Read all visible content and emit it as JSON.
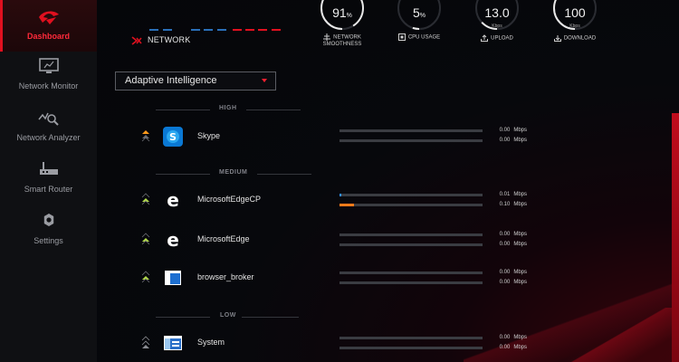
{
  "sidebar": {
    "items": [
      {
        "label": "Dashboard",
        "icon": "rog-eye-icon",
        "active": true
      },
      {
        "label": "Network Monitor",
        "icon": "monitor-icon"
      },
      {
        "label": "Network Analyzer",
        "icon": "analyzer-icon"
      },
      {
        "label": "Smart Router",
        "icon": "router-icon"
      },
      {
        "label": "Settings",
        "icon": "gear-icon"
      }
    ]
  },
  "stats": {
    "network_label": "NETWORK",
    "smoothness": {
      "value": "91",
      "unit": "%",
      "label": "NETWORK SMOOTHNESS",
      "fraction": 0.91
    },
    "cpu": {
      "value": "5",
      "unit": "%",
      "label": "CPU USAGE",
      "fraction": 0.05
    },
    "upload": {
      "value": "13.0",
      "unit": "Kbps",
      "label": "UPLOAD",
      "fraction": 0.13
    },
    "download": {
      "value": "100",
      "unit": "Kbps",
      "label": "DOWNLOAD",
      "fraction": 0.5
    }
  },
  "mode": {
    "selected": "Adaptive Intelligence"
  },
  "priorities": {
    "high": "HIGH",
    "medium": "MEDIUM",
    "low": "LOW"
  },
  "apps": [
    {
      "name": "Skype",
      "icon": "skype-icon",
      "up": "0.00",
      "down": "0.00",
      "unit": "Mbps",
      "up_fill": 0,
      "down_fill": 0
    },
    {
      "name": "MicrosoftEdgeCP",
      "icon": "edge-icon",
      "up": "0.01",
      "down": "0.10",
      "unit": "Mbps",
      "up_fill": 0.1,
      "down_fill": 0.01
    },
    {
      "name": "MicrosoftEdge",
      "icon": "edge-icon",
      "up": "0.00",
      "down": "0.00",
      "unit": "Mbps",
      "up_fill": 0,
      "down_fill": 0
    },
    {
      "name": "browser_broker",
      "icon": "window-app-icon",
      "up": "0.00",
      "down": "0.00",
      "unit": "Mbps",
      "up_fill": 0,
      "down_fill": 0
    },
    {
      "name": "System",
      "icon": "system-app-icon",
      "up": "0.00",
      "down": "0.00",
      "unit": "Mbps",
      "up_fill": 0,
      "down_fill": 0
    }
  ],
  "colors": {
    "accent_red": "#e0101f",
    "upload_bar": "#2f8fff",
    "download_bar": "#ff7a1a",
    "prio_high": "#ff9a1a",
    "prio_medium": "#b6e04a"
  }
}
